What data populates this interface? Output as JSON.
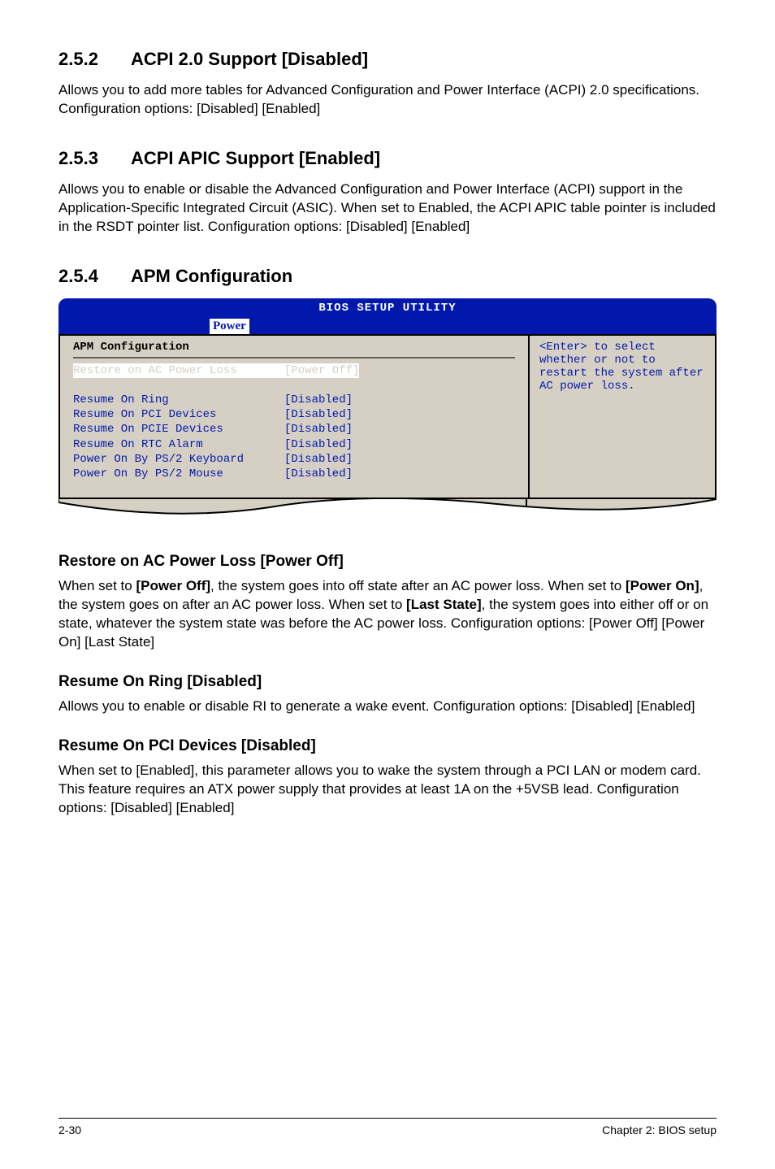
{
  "sections": {
    "s1": {
      "num": "2.5.2",
      "title": "ACPI 2.0 Support [Disabled]",
      "body": "Allows you to add more tables for Advanced Configuration and Power Interface (ACPI) 2.0 specifications. Configuration options: [Disabled] [Enabled]"
    },
    "s2": {
      "num": "2.5.3",
      "title": "ACPI APIC Support [Enabled]",
      "body": "Allows you to enable or disable the Advanced Configuration and Power Interface (ACPI) support in the Application-Specific Integrated Circuit (ASIC). When set to Enabled, the ACPI APIC table pointer is included in the RSDT pointer list. Configuration options: [Disabled] [Enabled]"
    },
    "s3": {
      "num": "2.5.4",
      "title": "APM Configuration"
    }
  },
  "bios": {
    "header_title": "BIOS SETUP UTILITY",
    "tab": "Power",
    "section_title": "APM Configuration",
    "rows": [
      {
        "label": "Restore on AC Power Loss",
        "value": "[Power Off]",
        "selected": true
      },
      {
        "label": "",
        "value": "",
        "selected": false
      },
      {
        "label": "Resume On Ring",
        "value": "[Disabled]",
        "selected": false
      },
      {
        "label": "Resume On PCI Devices",
        "value": "[Disabled]",
        "selected": false
      },
      {
        "label": "Resume On PCIE Devices",
        "value": "[Disabled]",
        "selected": false
      },
      {
        "label": "Resume On RTC Alarm",
        "value": "[Disabled]",
        "selected": false
      },
      {
        "label": "Power On By PS/2 Keyboard",
        "value": "[Disabled]",
        "selected": false
      },
      {
        "label": "Power On By PS/2 Mouse",
        "value": "[Disabled]",
        "selected": false
      }
    ],
    "help": "<Enter> to select whether or not to restart the system after AC power loss."
  },
  "subs": {
    "sub1": {
      "title": "Restore on AC Power Loss [Power Off]",
      "body_parts": [
        "When set to ",
        "[Power Off]",
        ", the system goes into off state after an AC power loss. When set to ",
        "[Power On]",
        ", the system goes on after an AC power loss. When set to ",
        "[Last State]",
        ", the system goes into either off or on state, whatever the system state was before the AC power loss. Configuration options: [Power Off] [Power On] [Last State]"
      ]
    },
    "sub2": {
      "title": "Resume On Ring [Disabled]",
      "body": "Allows you to enable or disable RI to generate a wake event. Configuration options: [Disabled] [Enabled]"
    },
    "sub3": {
      "title": "Resume On PCI Devices [Disabled]",
      "body": "When set to [Enabled], this parameter allows you to wake the system through a PCI LAN or modem card. This feature requires an ATX power supply that provides at least 1A on the +5VSB lead. Configuration options: [Disabled] [Enabled]"
    }
  },
  "footer": {
    "left": "2-30",
    "right": "Chapter 2: BIOS setup"
  }
}
